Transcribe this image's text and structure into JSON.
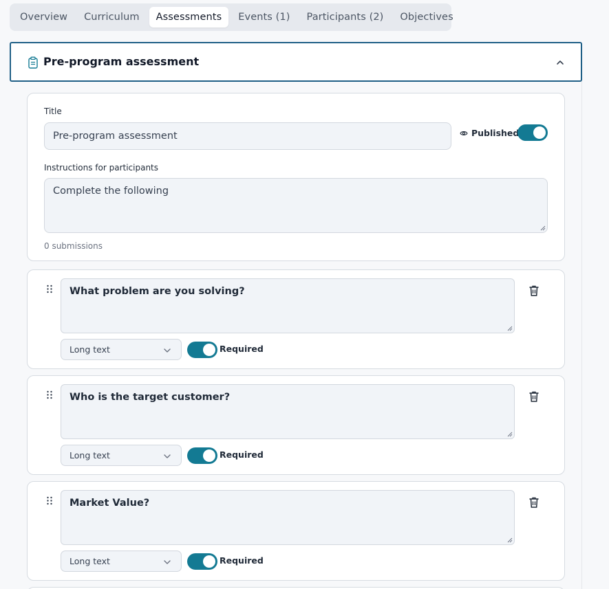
{
  "tabs": [
    {
      "label": "Overview",
      "active": false
    },
    {
      "label": "Curriculum",
      "active": false
    },
    {
      "label": "Assessments",
      "active": true
    },
    {
      "label": "Events (1)",
      "active": false
    },
    {
      "label": "Participants (2)",
      "active": false
    },
    {
      "label": "Objectives",
      "active": false
    }
  ],
  "section": {
    "title": "Pre-program assessment",
    "icon": "clipboard-icon",
    "expanded": true
  },
  "form": {
    "title_label": "Title",
    "title_value": "Pre-program assessment",
    "published_label": "Published",
    "published_on": true,
    "instructions_label": "Instructions for participants",
    "instructions_value": "Complete the following",
    "submissions": "0 submissions"
  },
  "questions": [
    {
      "text": "What problem are you solving?",
      "type": "Long text",
      "required_label": "Required",
      "required_on": true
    },
    {
      "text": "Who is the target customer?",
      "type": "Long text",
      "required_label": "Required",
      "required_on": true
    },
    {
      "text": "Market Value?",
      "type": "Long text",
      "required_label": "Required",
      "required_on": true
    }
  ],
  "colors": {
    "accent": "#137a93",
    "header_border": "#1f5f86",
    "input_bg": "#f1f4f8",
    "page_bg": "#f7f8fa"
  }
}
